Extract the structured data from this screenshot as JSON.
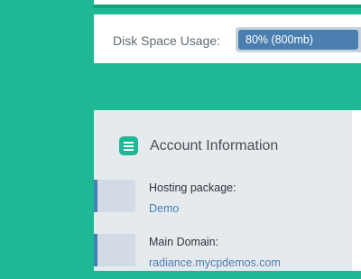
{
  "disk": {
    "label": "Disk Space Usage:",
    "percent": 80,
    "bar_text": "80%  (800mb)",
    "bar_color": "#4a7fb0"
  },
  "account": {
    "title": "Account Information",
    "icon": "list-icon",
    "items": [
      {
        "label": "Hosting package:",
        "value": "Demo"
      },
      {
        "label": "Main Domain:",
        "value": "radiance.mycpdemos.com"
      }
    ]
  },
  "colors": {
    "background": "#1eb894",
    "link": "#4a7fb0",
    "panel": "#e5eaef"
  }
}
